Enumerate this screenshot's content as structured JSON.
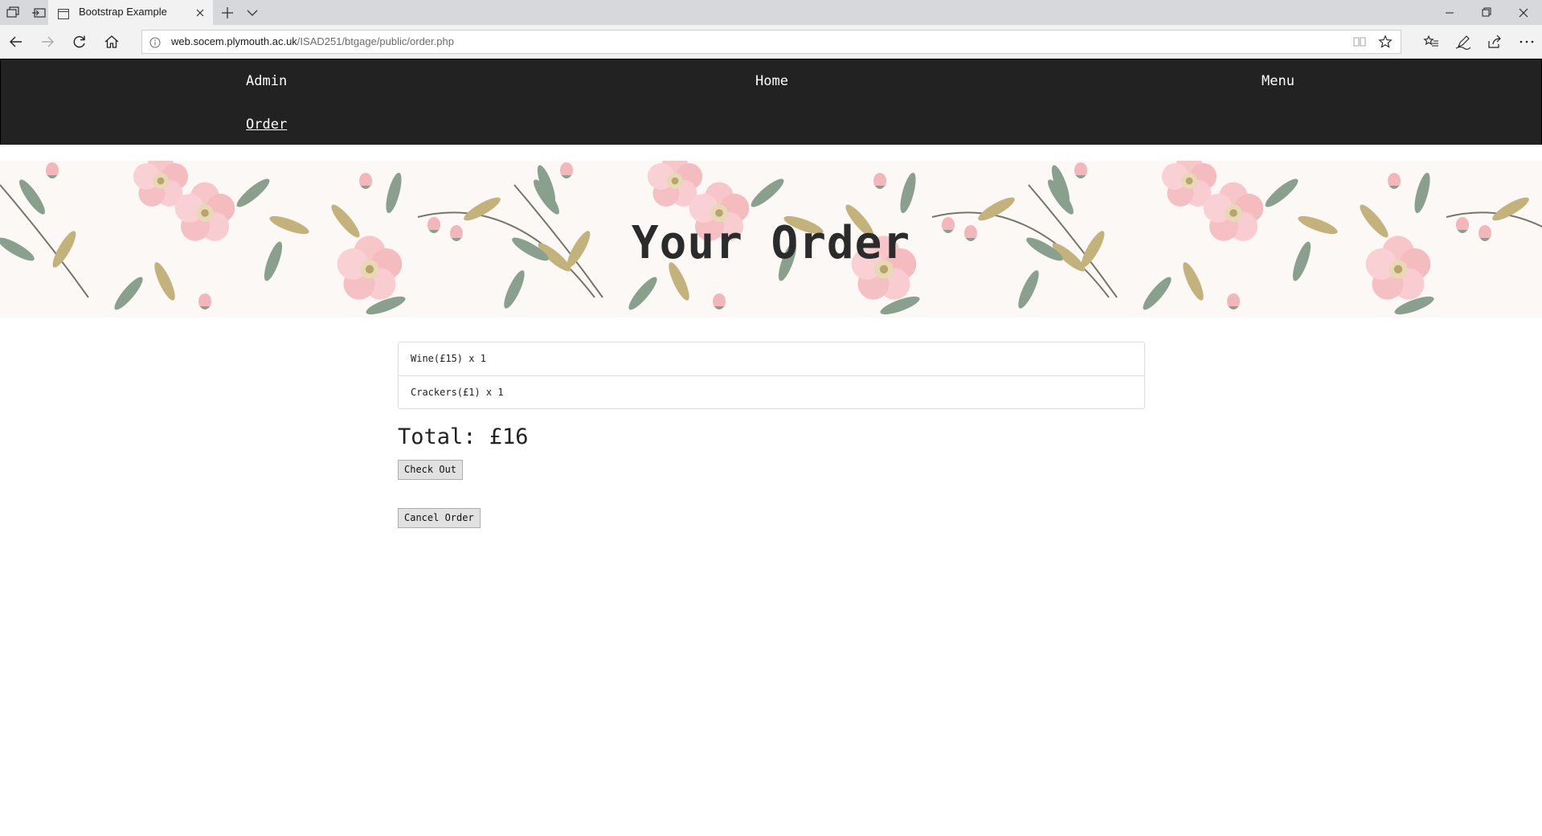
{
  "browser": {
    "tab_title": "Bootstrap Example",
    "url_host": "web.socem.plymouth.ac.uk",
    "url_path": "/ISAD251/btgage/public/order.php"
  },
  "nav": {
    "items": [
      {
        "label": "Admin"
      },
      {
        "label": "Home"
      },
      {
        "label": "Menu"
      },
      {
        "label": "Order"
      }
    ]
  },
  "hero": {
    "title": "Your Order"
  },
  "order": {
    "items": [
      {
        "text": "Wine(£15) x 1"
      },
      {
        "text": "Crackers(£1) x 1"
      }
    ],
    "total": "Total: £16",
    "checkout_label": "Check Out",
    "cancel_label": "Cancel Order"
  },
  "colors": {
    "navbar_bg": "#222222",
    "tab_bar_bg": "#d6d8db",
    "chrome_bg": "#f2f2f2",
    "flower_pink": "#f7c6c9",
    "leaf_green": "#8aa08f",
    "leaf_tan": "#c3b27c"
  },
  "icons": [
    "tab-list-icon",
    "set-aside-tabs-icon",
    "page-icon",
    "close-icon",
    "new-tab-icon",
    "chevron-down-icon",
    "minimize-icon",
    "restore-icon",
    "back-icon",
    "forward-icon",
    "refresh-icon",
    "home-icon",
    "info-icon",
    "reading-view-icon",
    "star-icon",
    "favorites-icon",
    "pen-icon",
    "share-icon",
    "more-icon"
  ]
}
